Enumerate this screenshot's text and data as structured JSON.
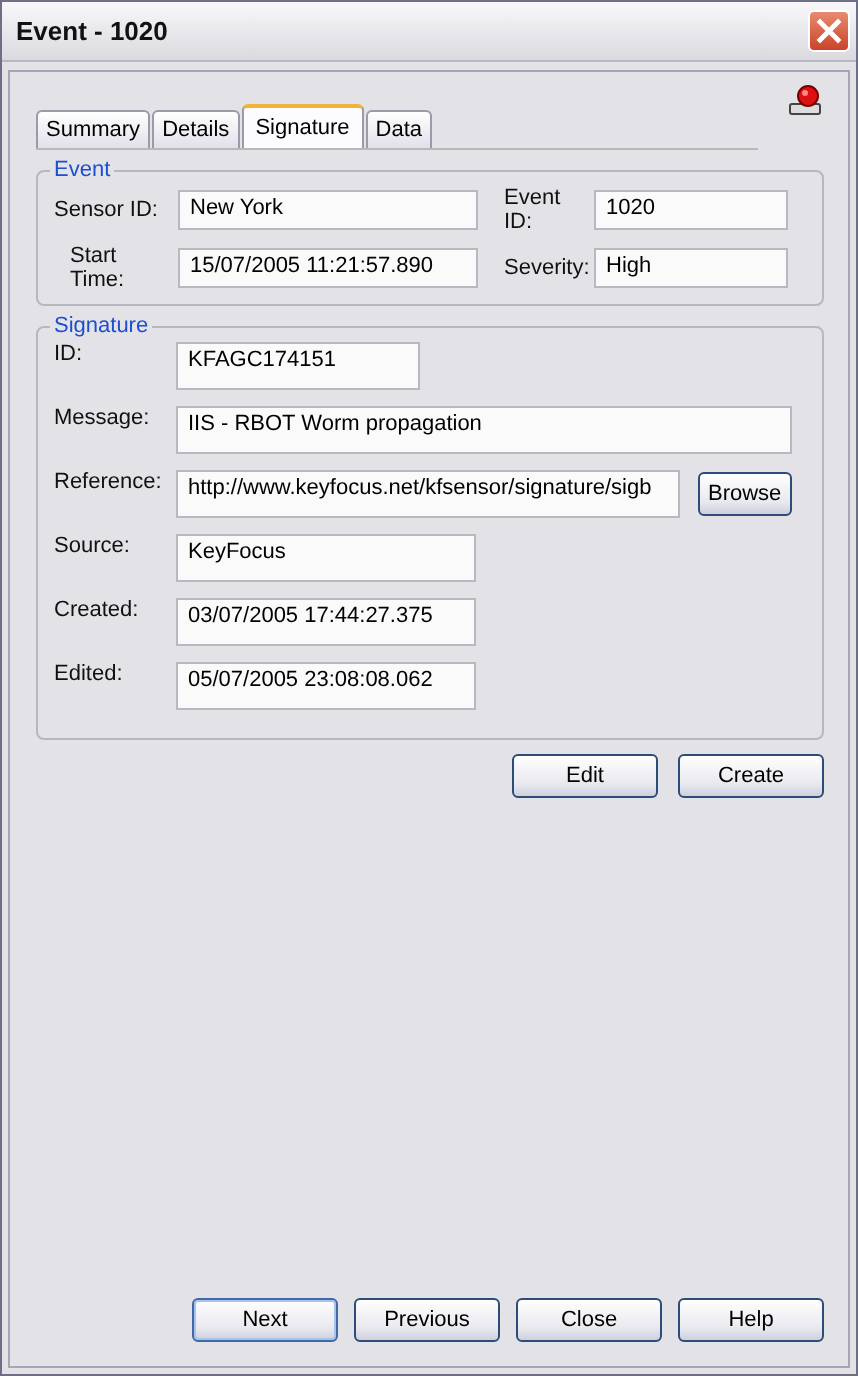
{
  "window": {
    "title": "Event - 1020"
  },
  "tabs": [
    {
      "label": "Summary",
      "selected": false
    },
    {
      "label": "Details",
      "selected": false
    },
    {
      "label": "Signature",
      "selected": true
    },
    {
      "label": "Data",
      "selected": false
    }
  ],
  "event_group": {
    "title": "Event",
    "fields": [
      {
        "label": "Sensor ID:",
        "value": "New York"
      },
      {
        "label": "Event ID:",
        "value": "1020"
      },
      {
        "label": "Start Time:",
        "value": "15/07/2005 11:21:57.890"
      },
      {
        "label": "Severity:",
        "value": "High"
      }
    ]
  },
  "signature_group": {
    "title": "Signature",
    "fields": [
      {
        "label": "ID:",
        "value": "KFAGC174151",
        "kind": "short"
      },
      {
        "label": "Message:",
        "value": "IIS - RBOT Worm propagation",
        "kind": "wide"
      },
      {
        "label": "Reference:",
        "value": "http://www.keyfocus.net/kfsensor/signature/sigb",
        "kind": "browse",
        "button": "Browse"
      },
      {
        "label": "Source:",
        "value": "KeyFocus",
        "kind": "medium"
      },
      {
        "label": "Created:",
        "value": "03/07/2005 17:44:27.375",
        "kind": "medium"
      },
      {
        "label": "Edited:",
        "value": "05/07/2005 23:08:08.062",
        "kind": "medium"
      }
    ]
  },
  "signature_buttons": [
    "Edit",
    "Create"
  ],
  "footer_buttons": [
    {
      "label": "Next",
      "default": true
    },
    {
      "label": "Previous",
      "default": false
    },
    {
      "label": "Close",
      "default": false
    },
    {
      "label": "Help",
      "default": false
    }
  ]
}
